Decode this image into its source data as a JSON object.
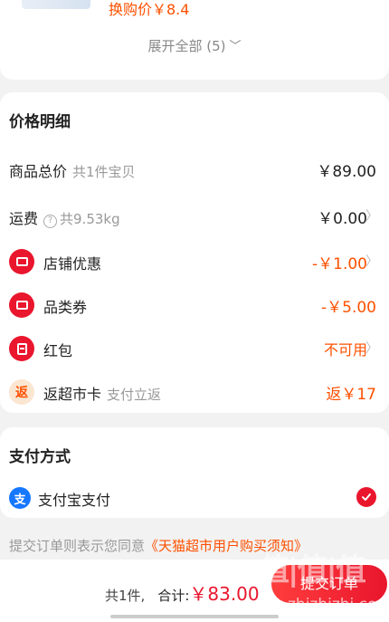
{
  "top": {
    "promo_price": "换购价￥8.4",
    "expand_all": "展开全部 (5)"
  },
  "price_detail": {
    "title": "价格明细",
    "rows": [
      {
        "label": "商品总价",
        "sub": "共1件宝贝",
        "value": "￥89.00"
      },
      {
        "label": "运费",
        "sub": "共9.53kg",
        "value": "￥0.00"
      },
      {
        "label": "店铺优惠",
        "value": "-￥1.00"
      },
      {
        "label": "品类券",
        "value": "-￥5.00"
      },
      {
        "label": "红包",
        "value": "不可用"
      },
      {
        "label": "返超市卡",
        "sub": "支付立返",
        "value": "返￥17",
        "icon_text": "返"
      }
    ]
  },
  "payment": {
    "title": "支付方式",
    "method": "支付宝支付",
    "icon_text": "支"
  },
  "agreement": {
    "prefix": "提交订单则表示您同意",
    "link": "《天猫超市用户购买须知》"
  },
  "footer": {
    "count": "共1件,",
    "total_label": "合计:",
    "total": "￥83.00",
    "submit": "提交订单"
  },
  "watermark": {
    "logo": "值|值|值",
    "url": "zhizhizhi.com"
  },
  "colors": {
    "accent": "#ff5000",
    "red": "#e9162d",
    "alipay": "#1677ff"
  }
}
